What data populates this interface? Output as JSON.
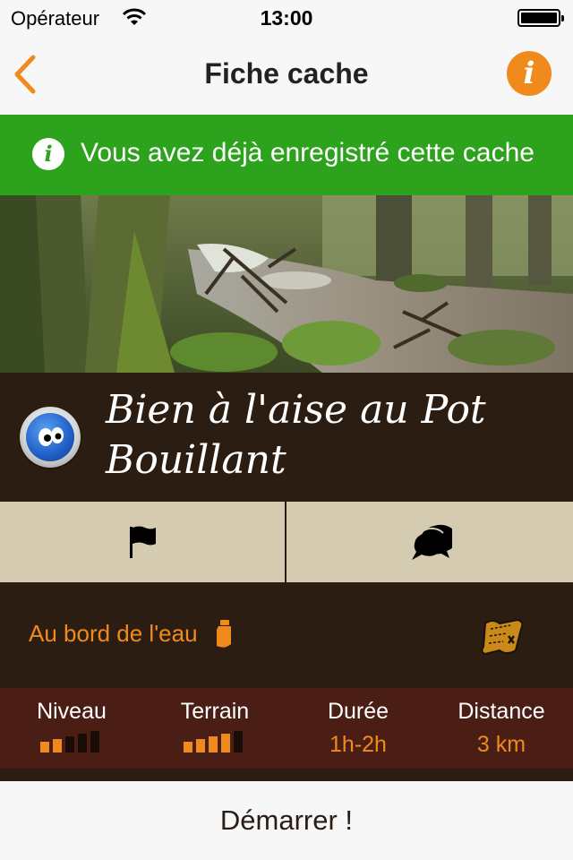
{
  "status_bar": {
    "carrier": "Opérateur",
    "time": "13:00"
  },
  "nav": {
    "title": "Fiche cache",
    "back_icon": "chevron-left-icon",
    "info_icon": "info-icon"
  },
  "banner": {
    "text": "Vous avez déjà enregistré cette cache",
    "color": "#2ca21d"
  },
  "cache": {
    "title": "Bien à l'aise au Pot Bouillant",
    "theme": "Au bord de l'eau",
    "theme_icon": "bottle-icon",
    "map_icon": "treasure-map-icon"
  },
  "actions": [
    {
      "icon": "flag-icon"
    },
    {
      "icon": "speech-bubbles-icon"
    }
  ],
  "stats": {
    "niveau": {
      "label": "Niveau",
      "level": 2,
      "max": 5
    },
    "terrain": {
      "label": "Terrain",
      "level": 4,
      "max": 5
    },
    "duree": {
      "label": "Durée",
      "value": "1h-2h"
    },
    "distance": {
      "label": "Distance",
      "value": "3 km"
    }
  },
  "start_label": "Démarrer !",
  "colors": {
    "accent": "#f08a1c",
    "dark_brown": "#2c1d13",
    "stats_bg": "#4a1e14",
    "button_beige": "#d4cbb0"
  }
}
